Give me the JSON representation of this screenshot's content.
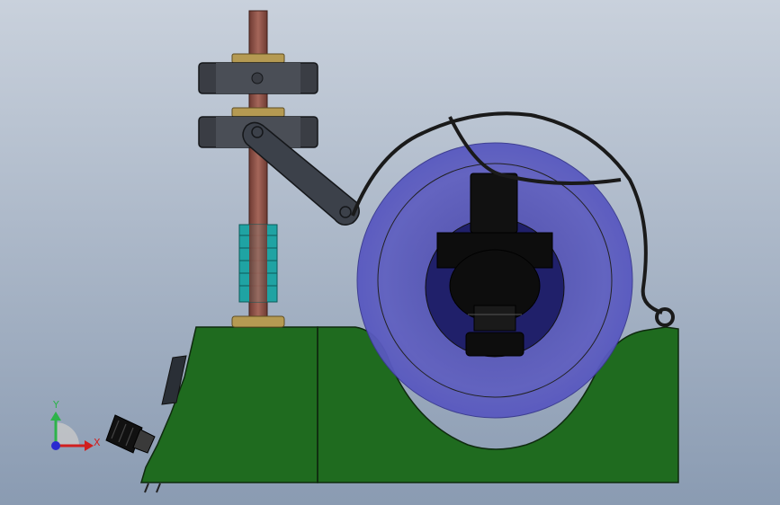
{
  "viewport": {
    "background_top": "#c9d1dc",
    "background_bottom": "#8a9bb2"
  },
  "triad": {
    "y_label": "Y",
    "x_label": "X",
    "y_color": "#2db34a",
    "x_color": "#d11f1f",
    "z_color": "#2a2ad0"
  },
  "model": {
    "base_color": "#1f6b1f",
    "rod_color": "#8b4a3f",
    "clamp_color": "#3a3d44",
    "collar_color": "#b59a52",
    "spring_color": "#1fa3a3",
    "arm_color": "#3c414a",
    "disc_color": "#5050b8",
    "probe_color": "#111111",
    "wire_color": "#1a1a1a"
  }
}
